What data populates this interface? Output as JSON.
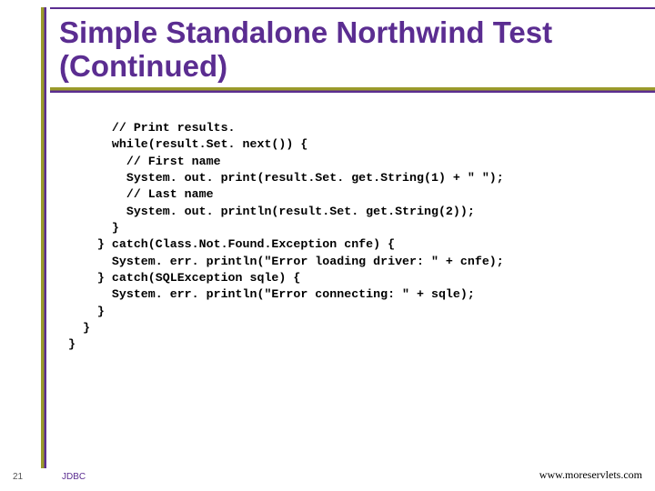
{
  "slide": {
    "title": "Simple Standalone Northwind Test (Continued)",
    "number": "21",
    "footer_left": "JDBC",
    "footer_right": "www.moreservlets.com"
  },
  "code": "      // Print results.\n      while(result.Set. next()) {\n        // First name\n        System. out. print(result.Set. get.String(1) + \" \");\n        // Last name\n        System. out. println(result.Set. get.String(2));\n      }\n    } catch(Class.Not.Found.Exception cnfe) {\n      System. err. println(\"Error loading driver: \" + cnfe);\n    } catch(SQLException sqle) {\n      System. err. println(\"Error connecting: \" + sqle);\n    }\n  }\n}"
}
